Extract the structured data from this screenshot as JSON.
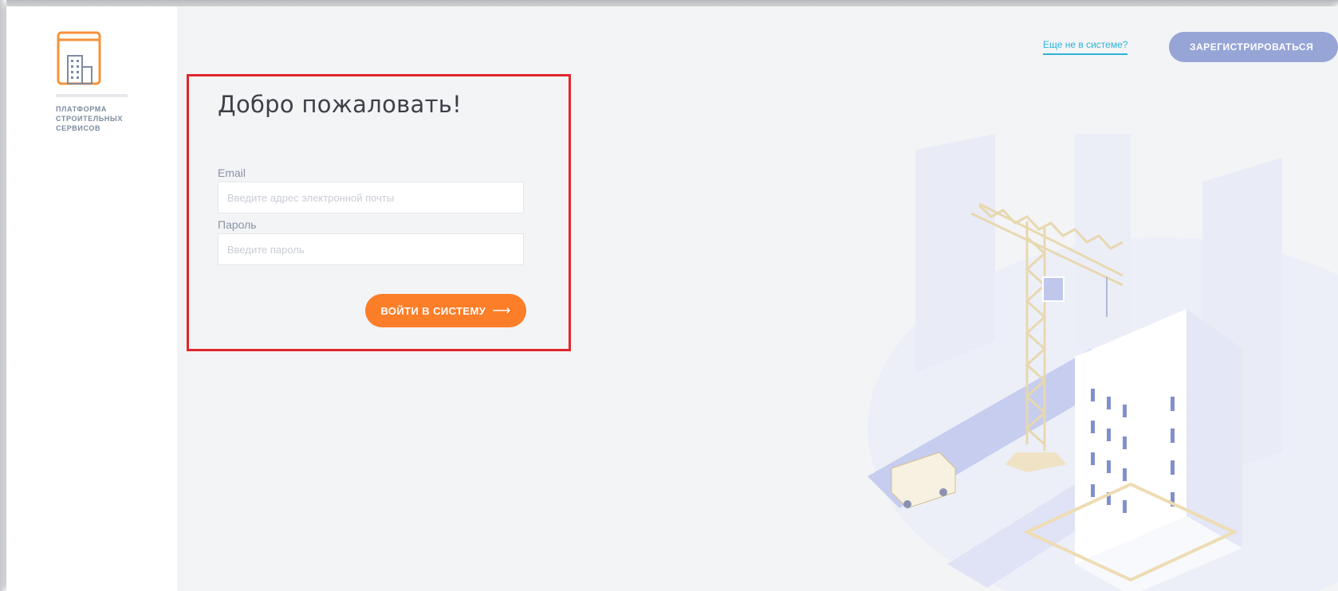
{
  "brand": {
    "name_lines": [
      "ПЛАТФОРМА",
      "СТРОИТЕЛЬНЫХ",
      "СЕРВИСОВ"
    ],
    "logo_icon": "building-logo-icon",
    "accent_color": "#f7923b"
  },
  "header": {
    "not_registered_link": "Еще не в системе?",
    "register_button": "ЗАРЕГИСТРИРОВАТЬСЯ"
  },
  "login_form": {
    "title": "Добро пожаловать!",
    "email_label": "Email",
    "email_placeholder": "Введите адрес электронной почты",
    "email_value": "",
    "password_label": "Пароль",
    "password_placeholder": "Введите пароль",
    "password_value": "",
    "submit_button": "ВОЙТИ В СИСТЕМУ",
    "submit_icon": "arrow-right-icon",
    "submit_color": "#fd7e29"
  },
  "illustration": {
    "icon": "construction-crane-building-illustration"
  },
  "colors": {
    "background": "#f3f4f6",
    "link": "#2ab3d8",
    "register_button": "#97a4d6",
    "highlight": "#e1262d"
  }
}
